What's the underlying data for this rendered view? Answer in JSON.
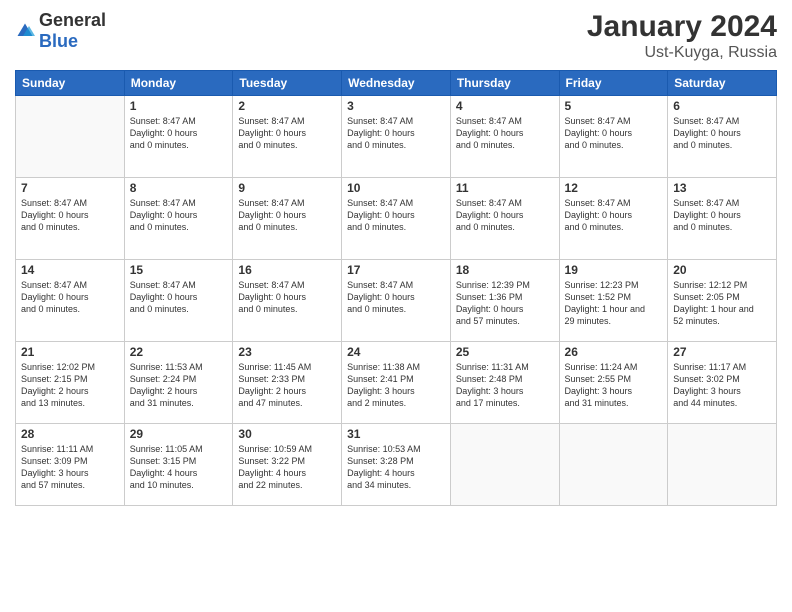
{
  "header": {
    "logo_general": "General",
    "logo_blue": "Blue",
    "month_year": "January 2024",
    "location": "Ust-Kuyga, Russia"
  },
  "weekdays": [
    "Sunday",
    "Monday",
    "Tuesday",
    "Wednesday",
    "Thursday",
    "Friday",
    "Saturday"
  ],
  "weeks": [
    [
      {
        "day": "",
        "info": ""
      },
      {
        "day": "1",
        "info": "Sunset: 8:47 AM\nDaylight: 0 hours\nand 0 minutes."
      },
      {
        "day": "2",
        "info": "Sunset: 8:47 AM\nDaylight: 0 hours\nand 0 minutes."
      },
      {
        "day": "3",
        "info": "Sunset: 8:47 AM\nDaylight: 0 hours\nand 0 minutes."
      },
      {
        "day": "4",
        "info": "Sunset: 8:47 AM\nDaylight: 0 hours\nand 0 minutes."
      },
      {
        "day": "5",
        "info": "Sunset: 8:47 AM\nDaylight: 0 hours\nand 0 minutes."
      },
      {
        "day": "6",
        "info": "Sunset: 8:47 AM\nDaylight: 0 hours\nand 0 minutes."
      }
    ],
    [
      {
        "day": "7",
        "info": "Sunset: 8:47 AM\nDaylight: 0 hours\nand 0 minutes."
      },
      {
        "day": "8",
        "info": "Sunset: 8:47 AM\nDaylight: 0 hours\nand 0 minutes."
      },
      {
        "day": "9",
        "info": "Sunset: 8:47 AM\nDaylight: 0 hours\nand 0 minutes."
      },
      {
        "day": "10",
        "info": "Sunset: 8:47 AM\nDaylight: 0 hours\nand 0 minutes."
      },
      {
        "day": "11",
        "info": "Sunset: 8:47 AM\nDaylight: 0 hours\nand 0 minutes."
      },
      {
        "day": "12",
        "info": "Sunset: 8:47 AM\nDaylight: 0 hours\nand 0 minutes."
      },
      {
        "day": "13",
        "info": "Sunset: 8:47 AM\nDaylight: 0 hours\nand 0 minutes."
      }
    ],
    [
      {
        "day": "14",
        "info": "Sunset: 8:47 AM\nDaylight: 0 hours\nand 0 minutes."
      },
      {
        "day": "15",
        "info": "Sunset: 8:47 AM\nDaylight: 0 hours\nand 0 minutes."
      },
      {
        "day": "16",
        "info": "Sunset: 8:47 AM\nDaylight: 0 hours\nand 0 minutes."
      },
      {
        "day": "17",
        "info": "Sunset: 8:47 AM\nDaylight: 0 hours\nand 0 minutes."
      },
      {
        "day": "18",
        "info": "Sunrise: 12:39 PM\nSunset: 1:36 PM\nDaylight: 0 hours\nand 57 minutes."
      },
      {
        "day": "19",
        "info": "Sunrise: 12:23 PM\nSunset: 1:52 PM\nDaylight: 1 hour and\n29 minutes."
      },
      {
        "day": "20",
        "info": "Sunrise: 12:12 PM\nSunset: 2:05 PM\nDaylight: 1 hour and\n52 minutes."
      }
    ],
    [
      {
        "day": "21",
        "info": "Sunrise: 12:02 PM\nSunset: 2:15 PM\nDaylight: 2 hours\nand 13 minutes."
      },
      {
        "day": "22",
        "info": "Sunrise: 11:53 AM\nSunset: 2:24 PM\nDaylight: 2 hours\nand 31 minutes."
      },
      {
        "day": "23",
        "info": "Sunrise: 11:45 AM\nSunset: 2:33 PM\nDaylight: 2 hours\nand 47 minutes."
      },
      {
        "day": "24",
        "info": "Sunrise: 11:38 AM\nSunset: 2:41 PM\nDaylight: 3 hours\nand 2 minutes."
      },
      {
        "day": "25",
        "info": "Sunrise: 11:31 AM\nSunset: 2:48 PM\nDaylight: 3 hours\nand 17 minutes."
      },
      {
        "day": "26",
        "info": "Sunrise: 11:24 AM\nSunset: 2:55 PM\nDaylight: 3 hours\nand 31 minutes."
      },
      {
        "day": "27",
        "info": "Sunrise: 11:17 AM\nSunset: 3:02 PM\nDaylight: 3 hours\nand 44 minutes."
      }
    ],
    [
      {
        "day": "28",
        "info": "Sunrise: 11:11 AM\nSunset: 3:09 PM\nDaylight: 3 hours\nand 57 minutes."
      },
      {
        "day": "29",
        "info": "Sunrise: 11:05 AM\nSunset: 3:15 PM\nDaylight: 4 hours\nand 10 minutes."
      },
      {
        "day": "30",
        "info": "Sunrise: 10:59 AM\nSunset: 3:22 PM\nDaylight: 4 hours\nand 22 minutes."
      },
      {
        "day": "31",
        "info": "Sunrise: 10:53 AM\nSunset: 3:28 PM\nDaylight: 4 hours\nand 34 minutes."
      },
      {
        "day": "",
        "info": ""
      },
      {
        "day": "",
        "info": ""
      },
      {
        "day": "",
        "info": ""
      }
    ]
  ]
}
